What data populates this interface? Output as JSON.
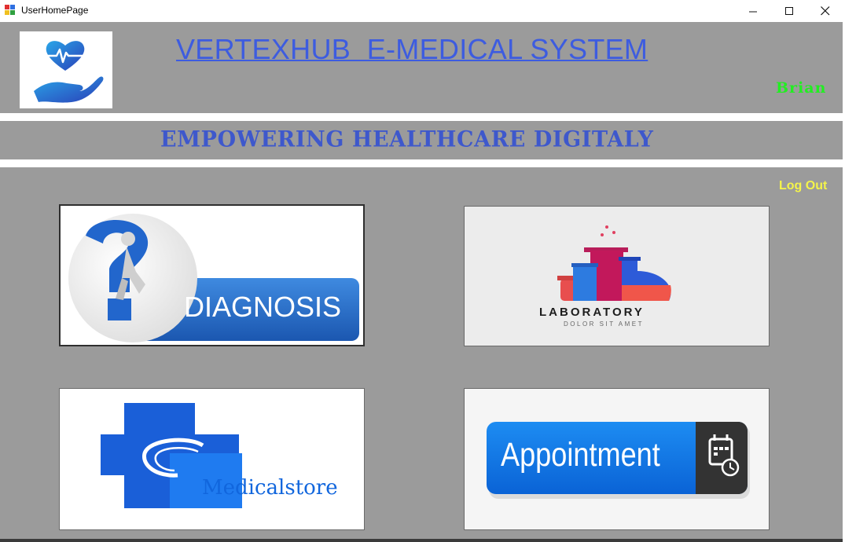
{
  "window": {
    "title": "UserHomePage",
    "controls": [
      "minimize",
      "maximize",
      "close"
    ]
  },
  "header": {
    "app_title": "VERTEXHUB  E-MEDICAL SYSTEM",
    "username": "Brian",
    "logo_icon": "heart-pulse-hand-icon"
  },
  "banner": {
    "tagline": "EMPOWERING HEALTHCARE DIGITALY"
  },
  "actions": {
    "logout_label": "Log Out"
  },
  "tiles": {
    "diagnosis": {
      "label": "DIAGNOSIS",
      "icon": "question-mark-figure-icon"
    },
    "laboratory": {
      "label": "LABORATORY",
      "sublabel": "DOLOR SIT AMET",
      "icon": "test-tubes-icon"
    },
    "medicalstore": {
      "label": "Medicalstore",
      "icon": "medical-cross-icon"
    },
    "appointment": {
      "label": "Appointment",
      "icon": "calendar-clock-icon"
    }
  },
  "colors": {
    "background": "#9b9b9b",
    "title_blue": "#3d5ce0",
    "username_green": "#22ee22",
    "logout_yellow": "#f4f44a",
    "tagline_blue": "#3e58cc"
  }
}
